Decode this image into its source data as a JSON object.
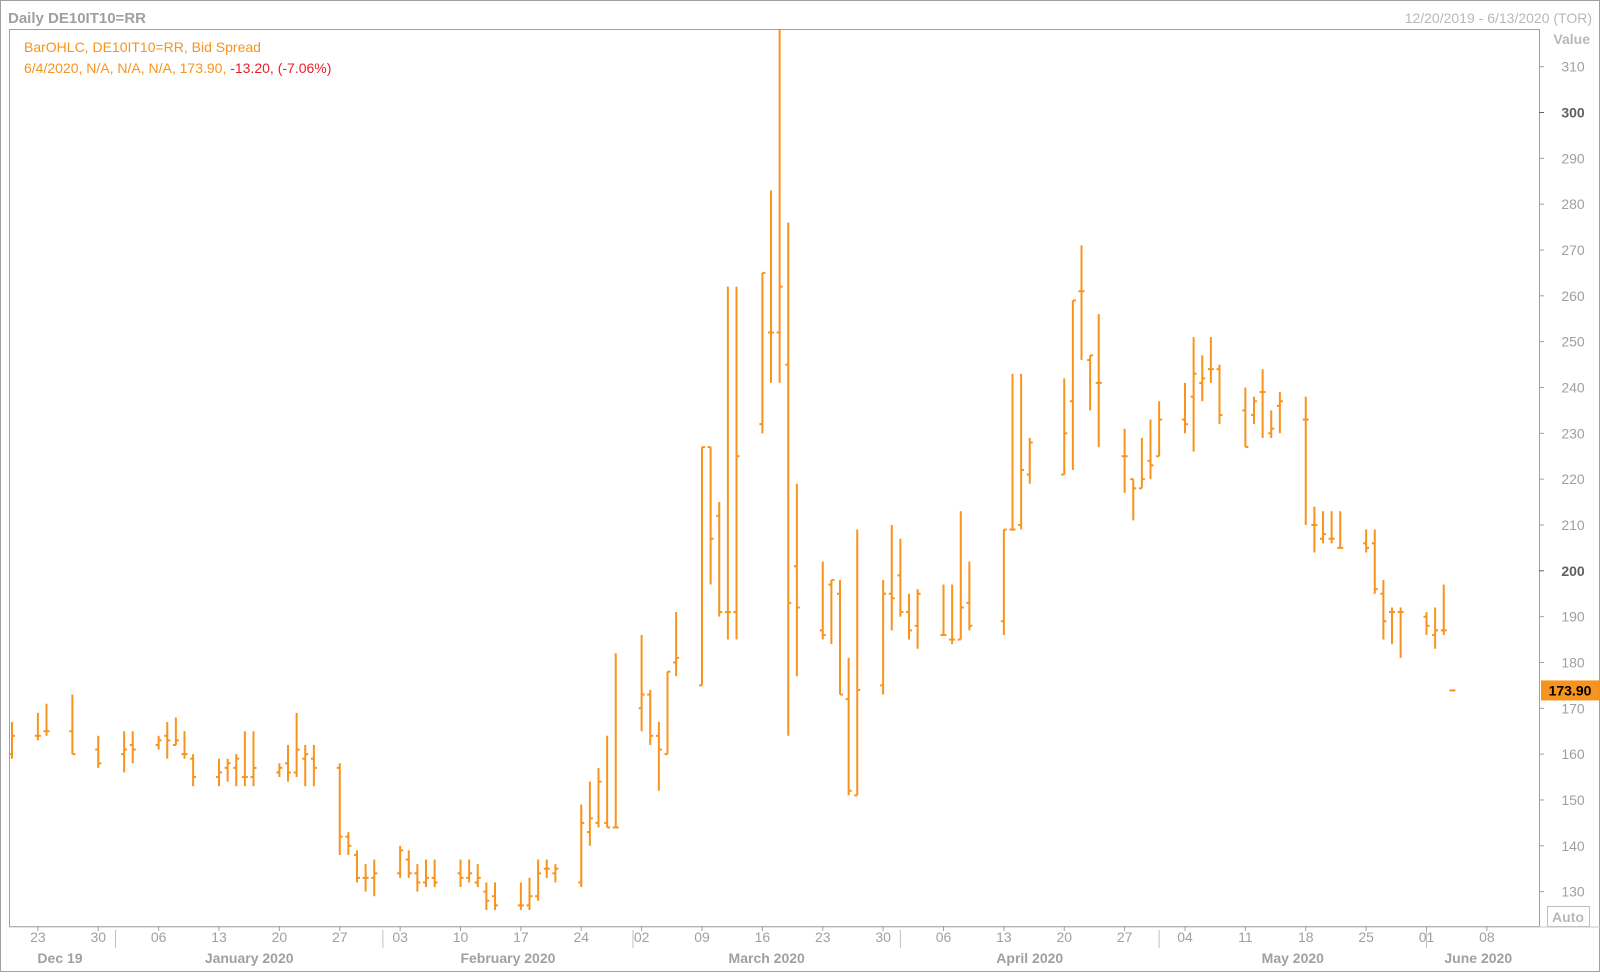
{
  "header": {
    "title": "Daily DE10IT10=RR",
    "date_range": "12/20/2019 - 6/13/2020 (TOR)"
  },
  "legend": {
    "line1": "BarOHLC, DE10IT10=RR, Bid Spread",
    "line2_prefix": "6/4/2020, N/A, N/A, N/A, 173.90, ",
    "line2_change": "-13.20, (-7.06%)"
  },
  "controls": {
    "auto_label": "Auto"
  },
  "colors": {
    "bars": "#f7941d",
    "change_negative": "#e8202a",
    "frame": "#a0a0a0",
    "last_price_bg": "#f7941d",
    "axis_text": "#a0a0a0"
  },
  "chart_data": {
    "type": "ohlc",
    "title": "Daily DE10IT10=RR",
    "series_name": "BarOHLC, DE10IT10=RR, Bid Spread",
    "ylabel": "Value",
    "ylim": [
      122.5,
      318
    ],
    "y_ticks": [
      130,
      140,
      150,
      160,
      170,
      180,
      190,
      200,
      210,
      220,
      230,
      240,
      250,
      260,
      270,
      280,
      290,
      300,
      310
    ],
    "y_ticks_bold": [
      200,
      300
    ],
    "last_value": "173.90",
    "x_range": [
      "2019-12-20",
      "2020-06-13"
    ],
    "x_ticks": [
      {
        "date": "2019-12-23",
        "label": "23"
      },
      {
        "date": "2019-12-30",
        "label": "30"
      },
      {
        "date": "2020-01-06",
        "label": "06"
      },
      {
        "date": "2020-01-13",
        "label": "13"
      },
      {
        "date": "2020-01-20",
        "label": "20"
      },
      {
        "date": "2020-01-27",
        "label": "27"
      },
      {
        "date": "2020-02-03",
        "label": "03"
      },
      {
        "date": "2020-02-10",
        "label": "10"
      },
      {
        "date": "2020-02-17",
        "label": "17"
      },
      {
        "date": "2020-02-24",
        "label": "24"
      },
      {
        "date": "2020-03-02",
        "label": "02"
      },
      {
        "date": "2020-03-09",
        "label": "09"
      },
      {
        "date": "2020-03-16",
        "label": "16"
      },
      {
        "date": "2020-03-23",
        "label": "23"
      },
      {
        "date": "2020-03-30",
        "label": "30"
      },
      {
        "date": "2020-04-06",
        "label": "06"
      },
      {
        "date": "2020-04-13",
        "label": "13"
      },
      {
        "date": "2020-04-20",
        "label": "20"
      },
      {
        "date": "2020-04-27",
        "label": "27"
      },
      {
        "date": "2020-05-04",
        "label": "04"
      },
      {
        "date": "2020-05-11",
        "label": "11"
      },
      {
        "date": "2020-05-18",
        "label": "18"
      },
      {
        "date": "2020-05-25",
        "label": "25"
      },
      {
        "date": "2020-06-01",
        "label": "01"
      },
      {
        "date": "2020-06-08",
        "label": "08"
      }
    ],
    "months": [
      {
        "label": "Dec 19",
        "start": "2019-12-20",
        "end": "2020-01-01"
      },
      {
        "label": "January 2020",
        "start": "2020-01-01",
        "end": "2020-02-01"
      },
      {
        "label": "February 2020",
        "start": "2020-02-01",
        "end": "2020-03-01"
      },
      {
        "label": "March 2020",
        "start": "2020-03-01",
        "end": "2020-04-01"
      },
      {
        "label": "April 2020",
        "start": "2020-04-01",
        "end": "2020-05-01"
      },
      {
        "label": "May 2020",
        "start": "2020-05-01",
        "end": "2020-06-01"
      },
      {
        "label": "June 2020",
        "start": "2020-06-01",
        "end": "2020-06-13"
      }
    ],
    "bars": [
      {
        "date": "2019-12-20",
        "open": 160,
        "high": 167,
        "low": 159,
        "close": 164
      },
      {
        "date": "2019-12-23",
        "open": 164,
        "high": 169,
        "low": 163,
        "close": 164
      },
      {
        "date": "2019-12-24",
        "open": 165,
        "high": 171,
        "low": 164,
        "close": 165
      },
      {
        "date": "2019-12-27",
        "open": 165,
        "high": 173,
        "low": 160,
        "close": 160
      },
      {
        "date": "2019-12-30",
        "open": 161,
        "high": 164,
        "low": 157,
        "close": 158
      },
      {
        "date": "2020-01-02",
        "open": 160,
        "high": 165,
        "low": 156,
        "close": 161
      },
      {
        "date": "2020-01-03",
        "open": 162,
        "high": 165,
        "low": 158,
        "close": 161
      },
      {
        "date": "2020-01-06",
        "open": 162,
        "high": 164,
        "low": 161,
        "close": 163
      },
      {
        "date": "2020-01-07",
        "open": 164,
        "high": 167,
        "low": 159,
        "close": 163
      },
      {
        "date": "2020-01-08",
        "open": 162,
        "high": 168,
        "low": 162,
        "close": 163
      },
      {
        "date": "2020-01-09",
        "open": 160,
        "high": 165,
        "low": 159,
        "close": 160
      },
      {
        "date": "2020-01-10",
        "open": 159,
        "high": 160,
        "low": 153,
        "close": 155
      },
      {
        "date": "2020-01-13",
        "open": 155,
        "high": 159,
        "low": 153,
        "close": 156
      },
      {
        "date": "2020-01-14",
        "open": 157,
        "high": 159,
        "low": 154,
        "close": 158
      },
      {
        "date": "2020-01-15",
        "open": 157,
        "high": 160,
        "low": 153,
        "close": 159
      },
      {
        "date": "2020-01-16",
        "open": 155,
        "high": 165,
        "low": 153,
        "close": 155
      },
      {
        "date": "2020-01-17",
        "open": 155,
        "high": 165,
        "low": 153,
        "close": 157
      },
      {
        "date": "2020-01-20",
        "open": 156,
        "high": 158,
        "low": 155,
        "close": 157
      },
      {
        "date": "2020-01-21",
        "open": 158,
        "high": 162,
        "low": 154,
        "close": 156
      },
      {
        "date": "2020-01-22",
        "open": 156,
        "high": 169,
        "low": 155,
        "close": 161
      },
      {
        "date": "2020-01-23",
        "open": 159,
        "high": 162,
        "low": 153,
        "close": 160
      },
      {
        "date": "2020-01-24",
        "open": 159,
        "high": 162,
        "low": 153,
        "close": 157
      },
      {
        "date": "2020-01-27",
        "open": 157,
        "high": 158,
        "low": 138,
        "close": 142
      },
      {
        "date": "2020-01-28",
        "open": 142,
        "high": 143,
        "low": 138,
        "close": 140
      },
      {
        "date": "2020-01-29",
        "open": 138,
        "high": 139,
        "low": 132,
        "close": 133
      },
      {
        "date": "2020-01-30",
        "open": 133,
        "high": 136,
        "low": 130,
        "close": 133
      },
      {
        "date": "2020-01-31",
        "open": 133,
        "high": 137,
        "low": 129,
        "close": 134
      },
      {
        "date": "2020-02-03",
        "open": 134,
        "high": 140,
        "low": 133,
        "close": 139
      },
      {
        "date": "2020-02-04",
        "open": 137,
        "high": 139,
        "low": 133,
        "close": 134
      },
      {
        "date": "2020-02-05",
        "open": 134,
        "high": 136,
        "low": 130,
        "close": 132
      },
      {
        "date": "2020-02-06",
        "open": 132,
        "high": 137,
        "low": 131,
        "close": 133
      },
      {
        "date": "2020-02-07",
        "open": 133,
        "high": 137,
        "low": 131,
        "close": 132
      },
      {
        "date": "2020-02-10",
        "open": 134,
        "high": 137,
        "low": 131,
        "close": 133
      },
      {
        "date": "2020-02-11",
        "open": 133,
        "high": 137,
        "low": 132,
        "close": 134
      },
      {
        "date": "2020-02-12",
        "open": 132,
        "high": 136,
        "low": 131,
        "close": 133
      },
      {
        "date": "2020-02-13",
        "open": 130,
        "high": 132,
        "low": 126,
        "close": 128
      },
      {
        "date": "2020-02-14",
        "open": 129,
        "high": 132,
        "low": 126,
        "close": 127
      },
      {
        "date": "2020-02-17",
        "open": 127,
        "high": 132,
        "low": 126,
        "close": 127
      },
      {
        "date": "2020-02-18",
        "open": 127,
        "high": 133,
        "low": 126,
        "close": 129
      },
      {
        "date": "2020-02-19",
        "open": 129,
        "high": 137,
        "low": 128,
        "close": 134
      },
      {
        "date": "2020-02-20",
        "open": 135,
        "high": 137,
        "low": 133,
        "close": 135
      },
      {
        "date": "2020-02-21",
        "open": 134,
        "high": 136,
        "low": 132,
        "close": 135
      },
      {
        "date": "2020-02-24",
        "open": 132,
        "high": 149,
        "low": 131,
        "close": 145
      },
      {
        "date": "2020-02-25",
        "open": 143,
        "high": 154,
        "low": 140,
        "close": 146
      },
      {
        "date": "2020-02-26",
        "open": 145,
        "high": 157,
        "low": 144,
        "close": 154
      },
      {
        "date": "2020-02-27",
        "open": 145,
        "high": 164,
        "low": 144,
        "close": 144
      },
      {
        "date": "2020-02-28",
        "open": 144,
        "high": 182,
        "low": 144,
        "close": 144
      },
      {
        "date": "2020-03-02",
        "open": 170,
        "high": 186,
        "low": 165,
        "close": 173
      },
      {
        "date": "2020-03-03",
        "open": 173,
        "high": 174,
        "low": 162,
        "close": 164
      },
      {
        "date": "2020-03-04",
        "open": 164,
        "high": 167,
        "low": 152,
        "close": 161
      },
      {
        "date": "2020-03-05",
        "open": 160,
        "high": 178,
        "low": 160,
        "close": 178
      },
      {
        "date": "2020-03-06",
        "open": 180,
        "high": 191,
        "low": 177,
        "close": 181
      },
      {
        "date": "2020-03-09",
        "open": 175,
        "high": 227,
        "low": 175,
        "close": 227
      },
      {
        "date": "2020-03-10",
        "open": 227,
        "high": 227,
        "low": 197,
        "close": 207
      },
      {
        "date": "2020-03-11",
        "open": 212,
        "high": 215,
        "low": 190,
        "close": 191
      },
      {
        "date": "2020-03-12",
        "open": 191,
        "high": 262,
        "low": 185,
        "close": 191
      },
      {
        "date": "2020-03-13",
        "open": 191,
        "high": 262,
        "low": 185,
        "close": 225
      },
      {
        "date": "2020-03-16",
        "open": 232,
        "high": 265,
        "low": 230,
        "close": 265
      },
      {
        "date": "2020-03-17",
        "open": 252,
        "high": 283,
        "low": 241,
        "close": 252
      },
      {
        "date": "2020-03-18",
        "open": 252,
        "high": 318,
        "low": 241,
        "close": 262
      },
      {
        "date": "2020-03-19",
        "open": 245,
        "high": 276,
        "low": 164,
        "close": 193
      },
      {
        "date": "2020-03-20",
        "open": 201,
        "high": 219,
        "low": 177,
        "close": 192
      },
      {
        "date": "2020-03-23",
        "open": 187,
        "high": 202,
        "low": 185,
        "close": 186
      },
      {
        "date": "2020-03-24",
        "open": 197,
        "high": 198,
        "low": 184,
        "close": 198
      },
      {
        "date": "2020-03-25",
        "open": 195,
        "high": 198,
        "low": 173,
        "close": 173
      },
      {
        "date": "2020-03-26",
        "open": 172,
        "high": 181,
        "low": 151,
        "close": 152
      },
      {
        "date": "2020-03-27",
        "open": 151,
        "high": 209,
        "low": 151,
        "close": 174
      },
      {
        "date": "2020-03-30",
        "open": 175,
        "high": 198,
        "low": 173,
        "close": 195
      },
      {
        "date": "2020-03-31",
        "open": 195,
        "high": 210,
        "low": 187,
        "close": 194
      },
      {
        "date": "2020-04-01",
        "open": 199,
        "high": 207,
        "low": 190,
        "close": 191
      },
      {
        "date": "2020-04-02",
        "open": 191,
        "high": 195,
        "low": 185,
        "close": 187
      },
      {
        "date": "2020-04-03",
        "open": 188,
        "high": 196,
        "low": 183,
        "close": 195
      },
      {
        "date": "2020-04-06",
        "open": 186,
        "high": 197,
        "low": 186,
        "close": 186
      },
      {
        "date": "2020-04-07",
        "open": 185,
        "high": 197,
        "low": 184,
        "close": 185
      },
      {
        "date": "2020-04-08",
        "open": 185,
        "high": 213,
        "low": 185,
        "close": 192
      },
      {
        "date": "2020-04-09",
        "open": 193,
        "high": 202,
        "low": 187,
        "close": 188
      },
      {
        "date": "2020-04-13",
        "open": 189,
        "high": 209,
        "low": 186,
        "close": 209
      },
      {
        "date": "2020-04-14",
        "open": 209,
        "high": 243,
        "low": 209,
        "close": 209
      },
      {
        "date": "2020-04-15",
        "open": 210,
        "high": 243,
        "low": 209,
        "close": 222
      },
      {
        "date": "2020-04-16",
        "open": 221,
        "high": 229,
        "low": 219,
        "close": 228
      },
      {
        "date": "2020-04-20",
        "open": 221,
        "high": 242,
        "low": 221,
        "close": 230
      },
      {
        "date": "2020-04-21",
        "open": 237,
        "high": 259,
        "low": 222,
        "close": 259
      },
      {
        "date": "2020-04-22",
        "open": 261,
        "high": 271,
        "low": 246,
        "close": 261
      },
      {
        "date": "2020-04-23",
        "open": 246,
        "high": 247,
        "low": 235,
        "close": 247
      },
      {
        "date": "2020-04-24",
        "open": 241,
        "high": 256,
        "low": 227,
        "close": 241
      },
      {
        "date": "2020-04-27",
        "open": 225,
        "high": 231,
        "low": 217,
        "close": 225
      },
      {
        "date": "2020-04-28",
        "open": 220,
        "high": 220,
        "low": 211,
        "close": 218
      },
      {
        "date": "2020-04-29",
        "open": 218,
        "high": 229,
        "low": 218,
        "close": 220
      },
      {
        "date": "2020-04-30",
        "open": 224,
        "high": 233,
        "low": 220,
        "close": 223
      },
      {
        "date": "2020-05-01",
        "open": 225,
        "high": 237,
        "low": 225,
        "close": 233
      },
      {
        "date": "2020-05-04",
        "open": 233,
        "high": 241,
        "low": 230,
        "close": 232
      },
      {
        "date": "2020-05-05",
        "open": 238,
        "high": 251,
        "low": 226,
        "close": 243
      },
      {
        "date": "2020-05-06",
        "open": 241,
        "high": 247,
        "low": 237,
        "close": 242
      },
      {
        "date": "2020-05-07",
        "open": 244,
        "high": 251,
        "low": 241,
        "close": 244
      },
      {
        "date": "2020-05-08",
        "open": 244,
        "high": 245,
        "low": 232,
        "close": 234
      },
      {
        "date": "2020-05-11",
        "open": 235,
        "high": 240,
        "low": 227,
        "close": 227
      },
      {
        "date": "2020-05-12",
        "open": 234,
        "high": 238,
        "low": 232,
        "close": 237
      },
      {
        "date": "2020-05-13",
        "open": 239,
        "high": 244,
        "low": 229,
        "close": 239
      },
      {
        "date": "2020-05-14",
        "open": 230,
        "high": 235,
        "low": 229,
        "close": 231
      },
      {
        "date": "2020-05-15",
        "open": 236,
        "high": 239,
        "low": 230,
        "close": 237
      },
      {
        "date": "2020-05-18",
        "open": 233,
        "high": 238,
        "low": 210,
        "close": 233
      },
      {
        "date": "2020-05-19",
        "open": 210,
        "high": 214,
        "low": 204,
        "close": 210
      },
      {
        "date": "2020-05-20",
        "open": 207,
        "high": 213,
        "low": 206,
        "close": 208
      },
      {
        "date": "2020-05-21",
        "open": 207,
        "high": 213,
        "low": 206,
        "close": 207
      },
      {
        "date": "2020-05-22",
        "open": 205,
        "high": 213,
        "low": 205,
        "close": 205
      },
      {
        "date": "2020-05-25",
        "open": 206,
        "high": 209,
        "low": 204,
        "close": 205
      },
      {
        "date": "2020-05-26",
        "open": 206,
        "high": 209,
        "low": 195,
        "close": 196
      },
      {
        "date": "2020-05-27",
        "open": 195,
        "high": 198,
        "low": 185,
        "close": 189
      },
      {
        "date": "2020-05-28",
        "open": 191,
        "high": 192,
        "low": 184,
        "close": 191
      },
      {
        "date": "2020-05-29",
        "open": 191,
        "high": 192,
        "low": 181,
        "close": 191
      },
      {
        "date": "2020-06-01",
        "open": 190,
        "high": 191,
        "low": 186,
        "close": 188
      },
      {
        "date": "2020-06-02",
        "open": 186,
        "high": 192,
        "low": 183,
        "close": 187
      },
      {
        "date": "2020-06-03",
        "open": 187,
        "high": 197,
        "low": 186,
        "close": 187
      },
      {
        "date": "2020-06-04",
        "open": null,
        "high": null,
        "low": null,
        "close": 173.9
      }
    ]
  }
}
